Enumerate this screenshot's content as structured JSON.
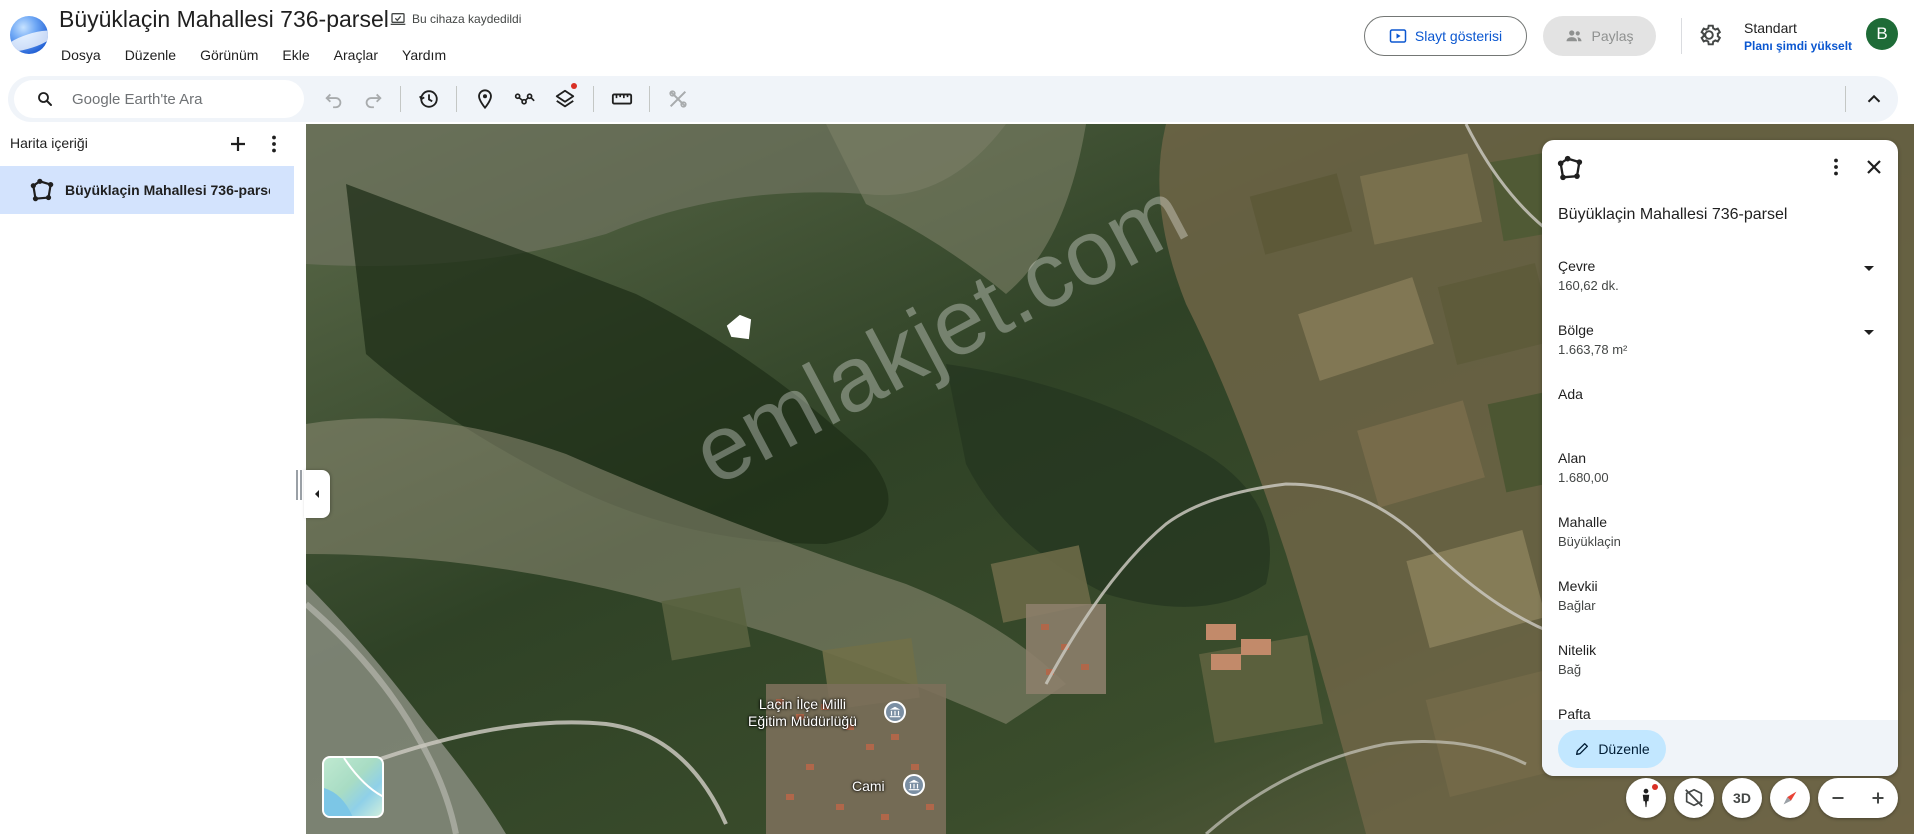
{
  "header": {
    "doc_title": "Büyüklaçin Mahallesi 736-parsel",
    "saved_status": "Bu cihaza kaydedildi",
    "menu": [
      "Dosya",
      "Düzenle",
      "Görünüm",
      "Ekle",
      "Araçlar",
      "Yardım"
    ],
    "slideshow_label": "Slayt gösterisi",
    "share_label": "Paylaş",
    "plan_name": "Standart",
    "plan_upgrade": "Planı şimdi yükselt",
    "avatar_letter": "B"
  },
  "toolbar": {
    "search_placeholder": "Google Earth'te Ara"
  },
  "sidebar": {
    "title": "Harita içeriği",
    "items": [
      {
        "label": "Büyüklaçin Mahallesi 736-parsel"
      }
    ]
  },
  "map": {
    "watermark": "emlakjet.com",
    "pois": [
      {
        "label_line1": "Laçin İlçe Milli",
        "label_line2": "Eğitim Müdürlüğü"
      },
      {
        "label_line1": "Cami",
        "label_line2": ""
      }
    ]
  },
  "panel": {
    "title": "Büyüklaçin Mahallesi 736-parsel",
    "attributes": [
      {
        "key": "Çevre",
        "value": "160,62 dk."
      },
      {
        "key": "Bölge",
        "value": "1.663,78 m²"
      },
      {
        "key": "Ada",
        "value": ""
      },
      {
        "key": "Alan",
        "value": "1.680,00"
      },
      {
        "key": "Mahalle",
        "value": "Büyüklaçin"
      },
      {
        "key": "Mevkii",
        "value": "Bağlar"
      },
      {
        "key": "Nitelik",
        "value": "Bağ"
      },
      {
        "key": "Pafta",
        "value": ""
      }
    ],
    "edit_label": "Düzenle"
  },
  "controls": {
    "view_3d_label": "3D"
  },
  "colors": {
    "accent": "#0b57d0",
    "selected_bg": "#d3e3fd",
    "edit_btn_bg": "#c2e7ff",
    "avatar_bg": "#1e6b37"
  }
}
